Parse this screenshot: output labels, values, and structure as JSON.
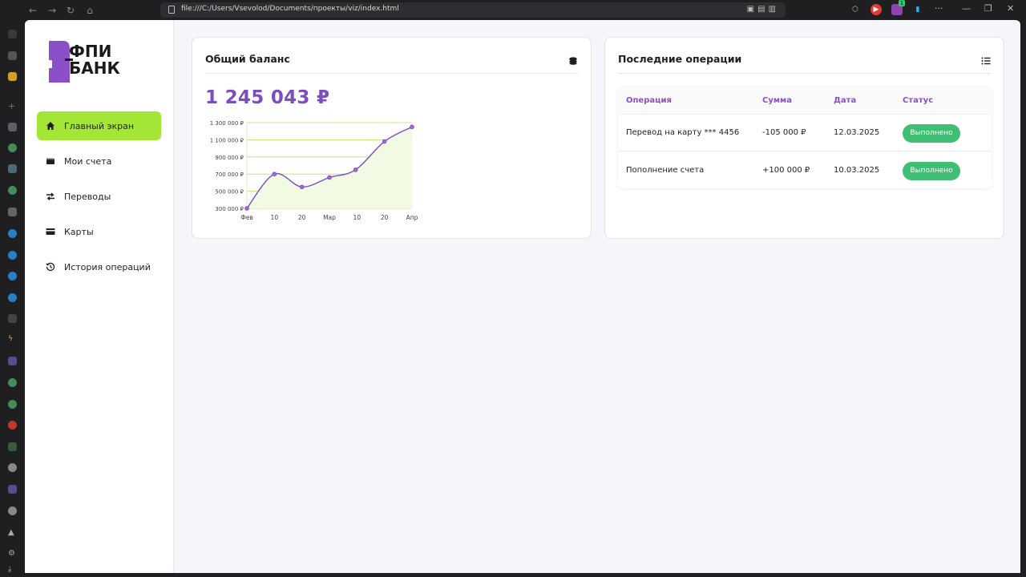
{
  "browser": {
    "url": "file:///C:/Users/Vsevolod/Documents/проекты/viz/index.html",
    "ext_badge": "1"
  },
  "brand": {
    "logo_line1": "ФПИ",
    "logo_line2": "БАНК",
    "accent": "#7c4dbd",
    "active_menu_color": "#a3e635",
    "status_color": "#3fbf74"
  },
  "sidebar": {
    "items": [
      {
        "label": "Главный экран",
        "icon": "home-icon",
        "active": true
      },
      {
        "label": "Мои счета",
        "icon": "wallet-icon",
        "active": false
      },
      {
        "label": "Переводы",
        "icon": "transfer-icon",
        "active": false
      },
      {
        "label": "Карты",
        "icon": "card-icon",
        "active": false
      },
      {
        "label": "История операций",
        "icon": "history-icon",
        "active": false
      }
    ]
  },
  "balance_card": {
    "title": "Общий баланс",
    "amount": "1 245 043 ₽",
    "icon": "coins-icon"
  },
  "ops_card": {
    "title": "Последние операции",
    "icon": "list-icon",
    "columns": [
      "Операция",
      "Сумма",
      "Дата",
      "Статус"
    ],
    "rows": [
      {
        "operation": "Перевод на карту *** 4456",
        "amount": "-105 000 ₽",
        "date": "12.03.2025",
        "status": "Выполнено"
      },
      {
        "operation": "Пополнение счета",
        "amount": "+100 000 ₽",
        "date": "10.03.2025",
        "status": "Выполнено"
      }
    ]
  },
  "chart_data": {
    "type": "area",
    "x": [
      "Фев",
      "10",
      "20",
      "Мар",
      "10",
      "20",
      "Апр"
    ],
    "points_x": [
      0,
      1,
      2,
      3,
      4,
      5,
      6
    ],
    "x_tick_labels": [
      "Фев",
      "10",
      "20",
      "Мар",
      "10",
      "20",
      "Апр"
    ],
    "values_x": [
      0,
      1,
      2,
      3,
      3.95,
      5,
      6
    ],
    "series": [
      {
        "values": [
          300000,
          700000,
          550000,
          660000,
          750000,
          1080000,
          1250000
        ]
      }
    ],
    "y_ticks": [
      "1 300 000 ₽",
      "1 100 000 ₽",
      "900 000 ₽",
      "700 000 ₽",
      "500 000 ₽",
      "300 000 ₽"
    ],
    "y_tick_values": [
      1300000,
      1100000,
      900000,
      700000,
      500000,
      300000
    ],
    "ylim": [
      300000,
      1300000
    ],
    "line_color": "#7c4dbd",
    "fill_color": "#f2fae3",
    "grid_color": "#b5e35a",
    "grid": true
  }
}
